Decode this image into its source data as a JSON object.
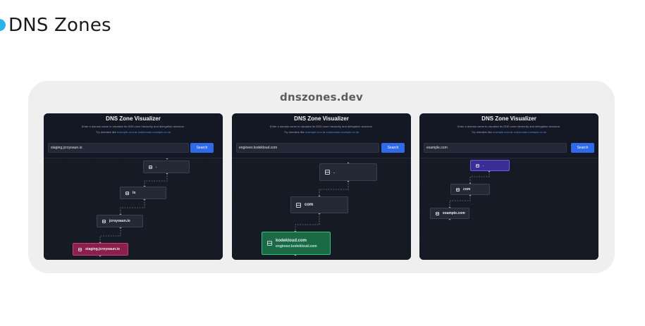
{
  "page": {
    "title": "DNS Zones"
  },
  "card": {
    "site": "dnszones.dev"
  },
  "panels": [
    {
      "title": "DNS Zone Visualizer",
      "subtitle": "Enter a domain name to visualize its DNS zone hierarchy and delegation structure.",
      "try_prefix": "Try domains like ",
      "try_example": "example.com",
      "try_or": " or ",
      "try_sub": "subdomain.example.co.uk",
      "input": "staging.jcroyoaun.io",
      "button": "Search",
      "nodes": [
        {
          "label": ".",
          "sub": ""
        },
        {
          "label": "io",
          "sub": ""
        },
        {
          "label": "jcroyoaun.io",
          "sub": ""
        },
        {
          "label": "staging.jcroyoaun.io",
          "sub": ""
        }
      ]
    },
    {
      "title": "DNS Zone Visualizer",
      "subtitle": "Enter a domain name to visualize its DNS zone hierarchy and delegation structure.",
      "try_prefix": "Try domains like ",
      "try_example": "example.com",
      "try_or": " or ",
      "try_sub": "subdomain.example.co.uk",
      "input": "engineer.kodekloud.com",
      "button": "Search",
      "nodes": [
        {
          "label": ".",
          "sub": ""
        },
        {
          "label": "com",
          "sub": ""
        },
        {
          "label": "kodekloud.com",
          "sub": "engineer.kodekloud.com"
        }
      ]
    },
    {
      "title": "DNS Zone Visualizer",
      "subtitle": "Enter a domain name to visualize its DNS zone hierarchy and delegation structure.",
      "try_prefix": "Try domains like ",
      "try_example": "example.com",
      "try_or": " or ",
      "try_sub": "subdomain.example.co.uk",
      "input": "example.com",
      "button": "Search",
      "nodes": [
        {
          "label": ".",
          "sub": ""
        },
        {
          "label": "com",
          "sub": ""
        },
        {
          "label": "example.com",
          "sub": ""
        }
      ]
    }
  ],
  "colors": {
    "accent": "#2f6ae8",
    "link": "#4a8cff",
    "node_target_1": "#8c1f4b",
    "node_target_2": "#1a6a46",
    "node_root_3": "#3a2d96",
    "header_dot": "#2bb3e8"
  },
  "icons": {
    "node": "server-icon"
  }
}
